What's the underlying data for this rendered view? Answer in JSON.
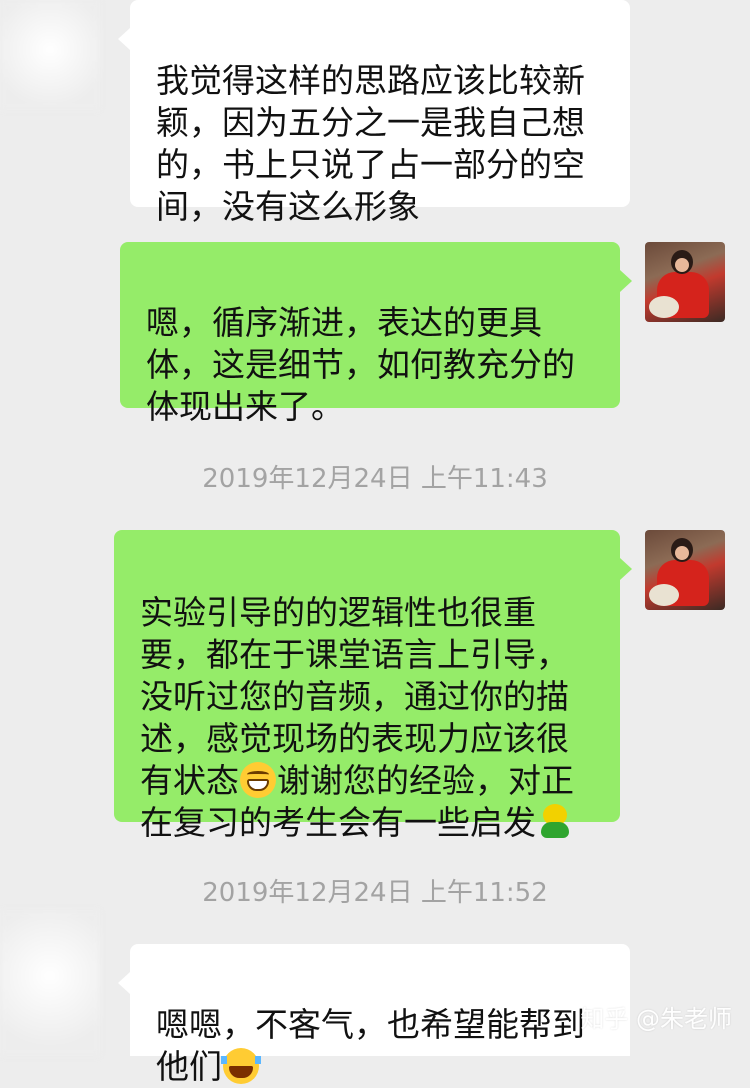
{
  "messages": [
    {
      "side": "in",
      "text": "我觉得这样的思路应该比较新\n颖，因为五分之一是我自己想\n的，书上只说了占一部分的空\n间，没有这么形象"
    },
    {
      "side": "out",
      "text": "嗯，循序渐进，表达的更具\n体，这是细节，如何教充分的\n体现出来了。"
    },
    {
      "side": "out",
      "text_a": "实验引导的的逻辑性也很重\n要，都在于课堂语言上引导，\n没听过您的音频，通过你的描\n述，感觉现场的表现力应该很\n有状态",
      "emoji_a": "grin-emoji",
      "text_b": "谢谢您的经验，对正\n在复习的考生会有一些启发",
      "emoji_b": "chick-emoji"
    },
    {
      "side": "in",
      "text": "嗯嗯，不客气，也希望能帮到\n他们",
      "emoji": "laughing-tears-emoji"
    }
  ],
  "timestamps": [
    "2019年12月24日 上午11:43",
    "2019年12月24日 上午11:52"
  ],
  "watermark": "知乎 @朱老师",
  "colors": {
    "background": "#ededed",
    "incoming": "#ffffff",
    "outgoing": "#95ec69",
    "timestamp": "#a3a3a3"
  }
}
